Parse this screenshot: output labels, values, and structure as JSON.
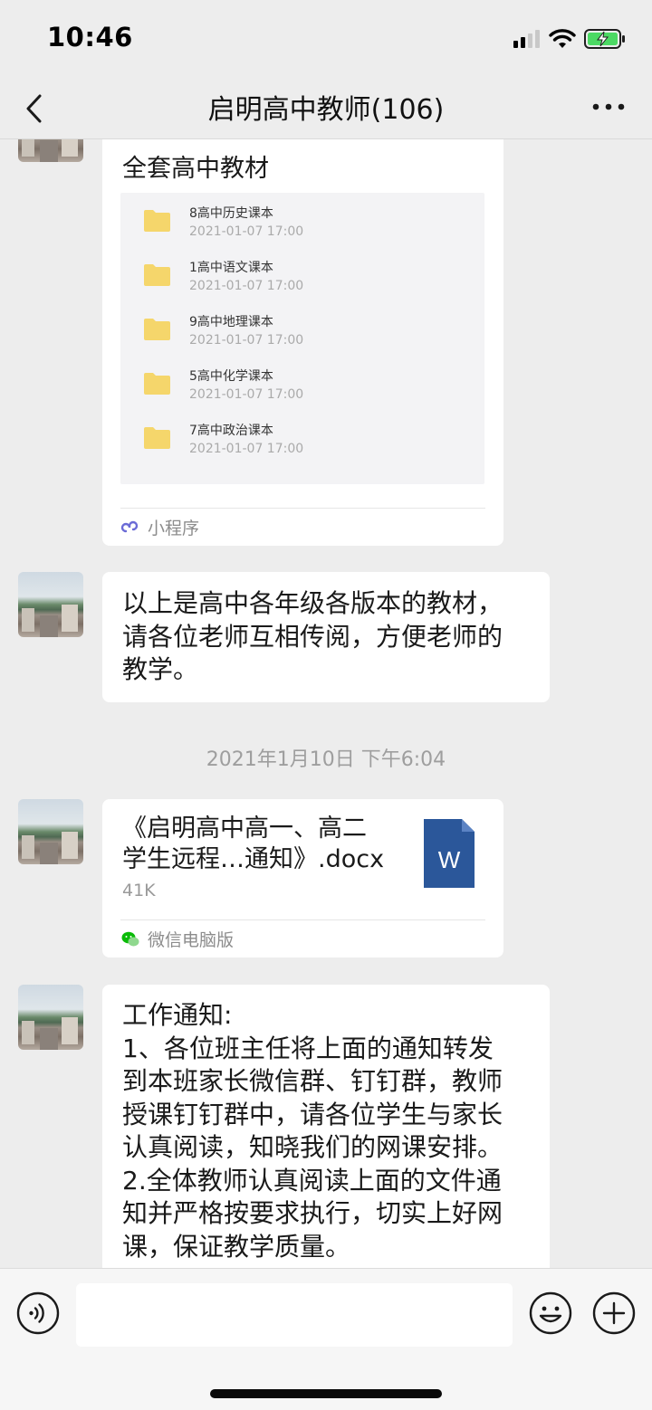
{
  "status_bar": {
    "time": "10:46"
  },
  "nav": {
    "title": "启明高中教师(106)"
  },
  "messages": {
    "mini_program": {
      "title": "全套高中教材",
      "folders": [
        {
          "name": "8高中历史课本",
          "date": "2021-01-07  17:00"
        },
        {
          "name": "1高中语文课本",
          "date": "2021-01-07  17:00"
        },
        {
          "name": "9高中地理课本",
          "date": "2021-01-07  17:00"
        },
        {
          "name": "5高中化学课本",
          "date": "2021-01-07  17:00"
        },
        {
          "name": "7高中政治课本",
          "date": "2021-01-07  17:00"
        }
      ],
      "footer": "小程序"
    },
    "text1": {
      "lines": [
        "以上是高中各年级各版本的教材，",
        "请各位老师互相传阅，方便老师的",
        "教学。"
      ]
    },
    "timestamp": "2021年1月10日 下午6:04",
    "file": {
      "name_lines": [
        "《启明高中高一、高二",
        "学生远程…通知》.docx"
      ],
      "size": "41K",
      "icon_letter": "W",
      "source": "微信电脑版"
    },
    "text2": {
      "lines": [
        "工作通知:",
        "1、各位班主任将上面的通知转发",
        "到本班家长微信群、钉钉群，教师",
        "授课钉钉群中，请各位学生与家长",
        "认真阅读，知晓我们的网课安排。",
        "2.全体教师认真阅读上面的文件通",
        "知并严格按要求执行，切实上好网",
        "课，保证教学质量。"
      ]
    }
  },
  "input_bar": {
    "placeholder": ""
  },
  "colors": {
    "background": "#ededed",
    "bubble": "#ffffff",
    "word_icon": "#2b579a",
    "folder": "#f5d66b"
  }
}
